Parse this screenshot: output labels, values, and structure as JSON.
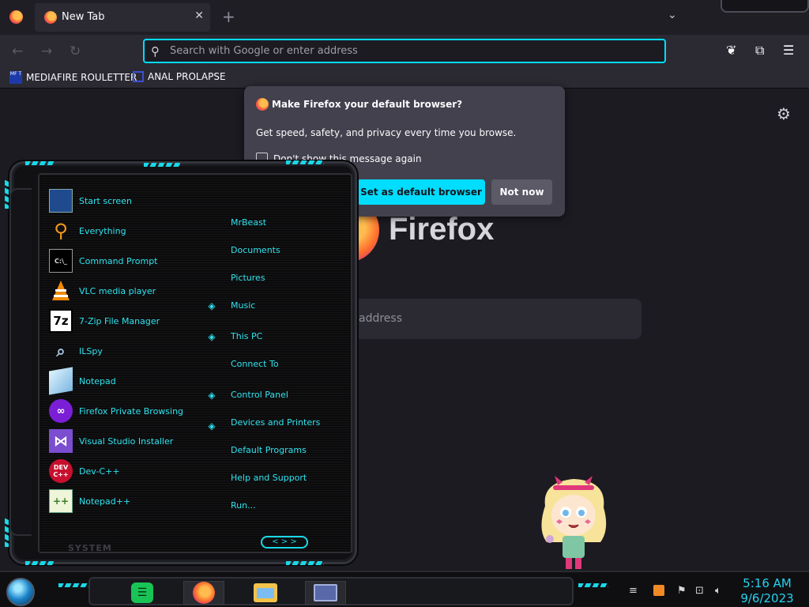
{
  "browser": {
    "tab_title": "New Tab",
    "tab_close": "✕",
    "new_tab": "+",
    "tab_list": "⌄",
    "back": "←",
    "forward": "→",
    "reload": "↻",
    "url_placeholder": "Search with Google or enter address",
    "pocket": "❦",
    "extensions": "⧉",
    "menu": "☰"
  },
  "bookmarks": [
    {
      "label": "MEDIAFIRE ROULETTER",
      "icon_text": "MF T"
    },
    {
      "label": "ANAL PROLAPSE"
    }
  ],
  "newtab": {
    "brand": "Firefox",
    "search_placeholder": "address",
    "settings_icon": "⚙"
  },
  "popup": {
    "title": "Make Firefox your default browser?",
    "body": "Get speed, safety, and privacy every time you browse.",
    "checkbox_label": "Don't show this message again",
    "primary_button": "Set as default browser",
    "secondary_button": "Not now"
  },
  "start_menu": {
    "programs": [
      {
        "label": "Start screen",
        "icon": "start-screen-icon"
      },
      {
        "label": "Everything",
        "icon": "magnifier-icon"
      },
      {
        "label": "Command Prompt",
        "icon": "terminal-icon",
        "icon_text": "C:\\_"
      },
      {
        "label": "VLC media player",
        "icon": "vlc-cone-icon"
      },
      {
        "label": "7-Zip File Manager",
        "icon": "7zip-icon",
        "icon_text": "7z"
      },
      {
        "label": "ILSpy",
        "icon": "ilspy-icon"
      },
      {
        "label": "Notepad",
        "icon": "notepad-icon"
      },
      {
        "label": "Firefox Private Browsing",
        "icon": "private-mask-icon"
      },
      {
        "label": "Visual Studio Installer",
        "icon": "visual-studio-icon"
      },
      {
        "label": "Dev-C++",
        "icon": "devcpp-icon",
        "icon_text": "DEV C++"
      },
      {
        "label": "Notepad++",
        "icon": "notepadpp-icon",
        "icon_text": "++"
      }
    ],
    "places": [
      "MrBeast",
      "Documents",
      "Pictures",
      "Music",
      "This PC",
      "Connect To",
      "Control Panel",
      "Devices and Printers",
      "Default Programs",
      "Help and Support",
      "Run..."
    ],
    "footer_label": "SYSTEM",
    "arrows": "< > >"
  },
  "taskbar": {
    "clock_time": "5:16 AM",
    "clock_date": "9/6/2023",
    "apps": [
      "notes-app-icon",
      "firefox-icon",
      "file-explorer-icon",
      "window-app-icon"
    ],
    "notes_glyph": "☰"
  },
  "colors": {
    "accent": "#00ddff",
    "cyan_text": "#2fe3ee",
    "chrome_dark": "#1c1b22"
  }
}
